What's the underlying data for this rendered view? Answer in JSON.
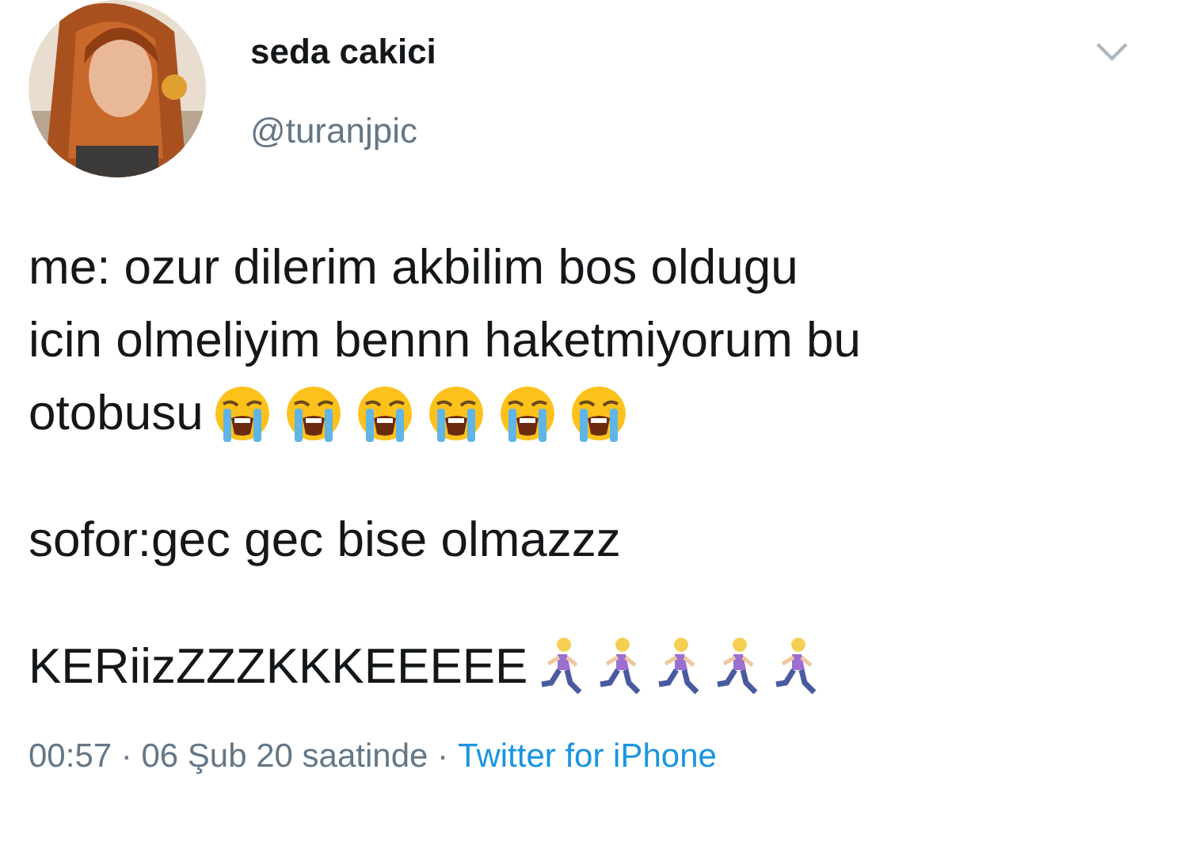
{
  "author": {
    "name": "seda cakici",
    "handle": "@turanjpic"
  },
  "paragraphs": [
    {
      "lines": [
        [
          {
            "kind": "text",
            "text": "me: ozur dilerim akbilim bos oldugu"
          }
        ],
        [
          {
            "kind": "text",
            "text": "icin olmeliyim bennn haketmiyorum bu"
          }
        ],
        [
          {
            "kind": "text",
            "text": "otobusu"
          },
          {
            "kind": "crying"
          },
          {
            "kind": "crying"
          },
          {
            "kind": "crying"
          },
          {
            "kind": "crying"
          },
          {
            "kind": "crying"
          },
          {
            "kind": "crying"
          }
        ]
      ]
    },
    {
      "lines": [
        [
          {
            "kind": "text",
            "text": "sofor:gec gec bise olmazzz"
          }
        ]
      ]
    },
    {
      "lines": [
        [
          {
            "kind": "text",
            "text": "KERiizZZZKKKEEEEE"
          },
          {
            "kind": "runner"
          },
          {
            "kind": "runner"
          },
          {
            "kind": "runner"
          },
          {
            "kind": "runner"
          },
          {
            "kind": "runner"
          }
        ]
      ]
    }
  ],
  "meta": {
    "time": "00:57 · 06 Şub 20 saatinde ·",
    "source": "Twitter for iPhone"
  }
}
